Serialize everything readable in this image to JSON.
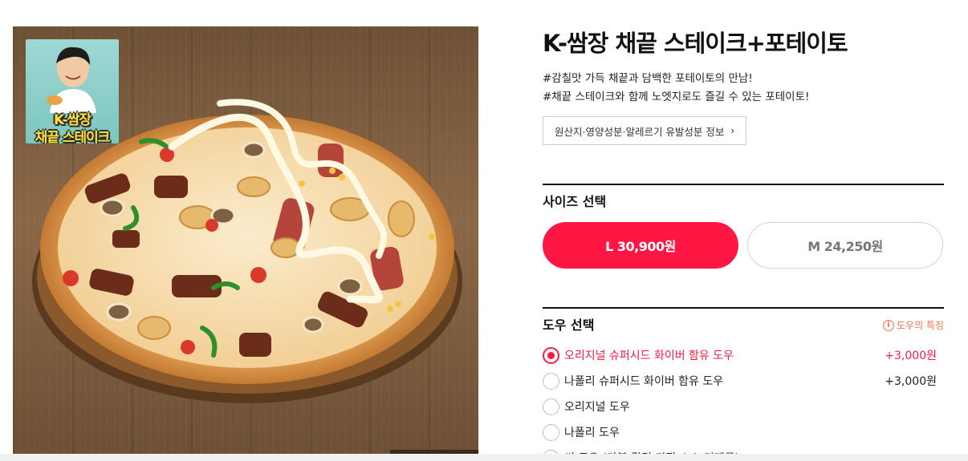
{
  "product": {
    "title": "K-쌈장 채끝 스테이크+포테이토",
    "description": [
      "#감칠맛 가득 채끝과 담백한 포테이토의 만남!",
      "#채끝 스테이크와 함께 노엣지로도 즐길 수 있는 포테이토!"
    ],
    "info_button_label": "원산지·영양성분·알레르기 유발성분 정보",
    "image_badge": {
      "line1": "K-쌈장",
      "line2": "채끝 스테이크"
    }
  },
  "size_section": {
    "title": "사이즈 선택",
    "options": [
      {
        "label": "L 30,900원",
        "selected": true
      },
      {
        "label": "M 24,250원",
        "selected": false
      }
    ]
  },
  "dough_section": {
    "title": "도우 선택",
    "feature_link": "도우의 특징",
    "options": [
      {
        "label": "오리지널 슈퍼시드 화이버 함유 도우",
        "price": "+3,000원",
        "selected": true
      },
      {
        "label": "나폴리 슈퍼시드 화이버 함유 도우",
        "price": "+3,000원",
        "selected": false
      },
      {
        "label": "오리지널 도우",
        "price": "",
        "selected": false
      },
      {
        "label": "나폴리 도우",
        "price": "",
        "selected": false
      },
      {
        "label": "씬 도우 (가블 갈릭 디핑 소스 미제공)",
        "price": "",
        "selected": false
      }
    ]
  },
  "colors": {
    "accent": "#ff1744",
    "feature_link": "#ff6b4a",
    "badge_text": "#ffe23a"
  },
  "icons": {
    "chevron": "chevron-right-icon",
    "info": "info-circle-icon"
  }
}
